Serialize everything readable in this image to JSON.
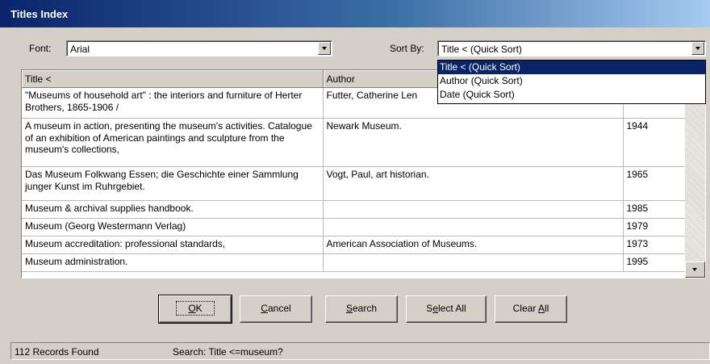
{
  "window": {
    "title": "Titles Index"
  },
  "font_control": {
    "label": "Font:",
    "value": "Arial"
  },
  "sort_control": {
    "label": "Sort By:",
    "value": "Title < (Quick Sort)",
    "options": [
      "Title < (Quick Sort)",
      "Author (Quick Sort)",
      "Date (Quick Sort)"
    ]
  },
  "table": {
    "columns": [
      "Title <",
      "Author",
      ""
    ],
    "rows": [
      {
        "title": "\"Museums of household art\" : the interiors and furniture of Herter Brothers, 1865-1906 /",
        "author": "Futter, Catherine Len",
        "date": ""
      },
      {
        "title": "A museum in action, presenting the museum's activities. Catalogue of an exhibition of American paintings and sculpture from the museum's collections,",
        "author": "Newark Museum.",
        "date": "1944"
      },
      {
        "title": "Das Museum Folkwang Essen; die Geschichte einer Sammlung junger Kunst im Ruhrgebiet.",
        "author": "Vogt, Paul, art historian.",
        "date": "1965"
      },
      {
        "title": "Museum & archival supplies handbook.",
        "author": "",
        "date": "1985"
      },
      {
        "title": "Museum (Georg Westermann Verlag)",
        "author": "",
        "date": "1979"
      },
      {
        "title": "Museum accreditation: professional standards,",
        "author": "American Association of Museums.",
        "date": "1973"
      },
      {
        "title": "Museum administration.",
        "author": "",
        "date": "1995"
      }
    ]
  },
  "buttons": {
    "ok": {
      "mnemonic": "O",
      "rest": "K"
    },
    "cancel": {
      "mnemonic": "C",
      "rest": "ancel"
    },
    "search": {
      "mnemonic": "S",
      "rest": "earch"
    },
    "select_all": {
      "pre": "S",
      "mnemonic": "e",
      "rest": "lect All"
    },
    "clear_all": {
      "pre": "Clear ",
      "mnemonic": "A",
      "rest": "ll"
    }
  },
  "status": {
    "records": "112 Records Found",
    "search": "Search: Title <=museum?"
  }
}
